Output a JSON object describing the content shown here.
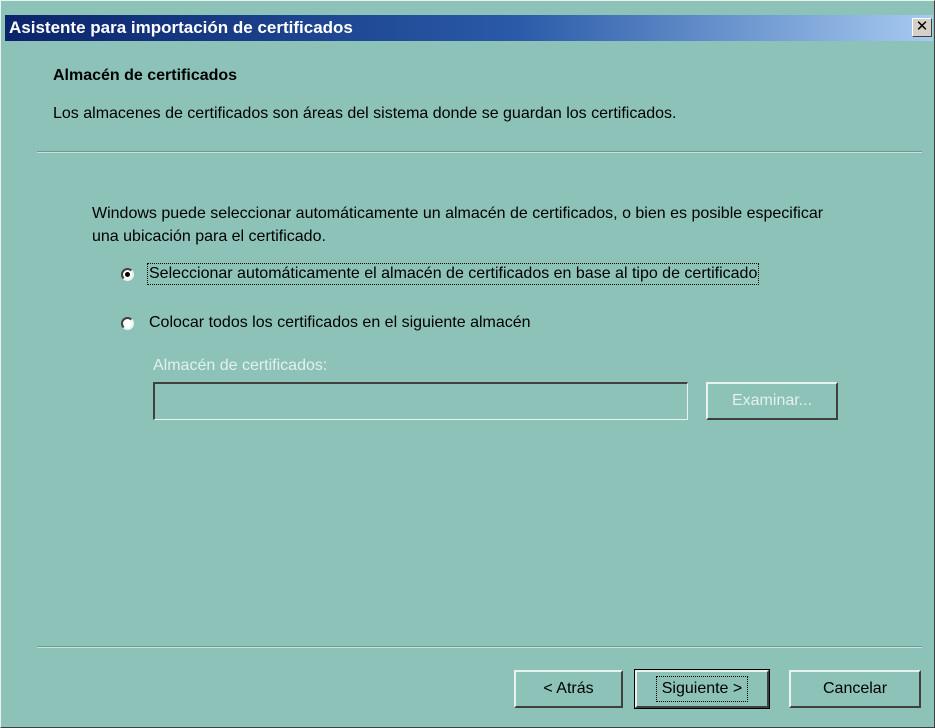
{
  "window": {
    "title": "Asistente para importación de certificados",
    "close_glyph": "✕"
  },
  "header": {
    "title": "Almacén de certificados",
    "description": "Los almacenes de certificados son áreas del sistema donde se guardan los certificados."
  },
  "body": {
    "intro": "Windows puede seleccionar automáticamente un almacén de certificados, o bien es posible especificar una ubicación para el certificado.",
    "options": [
      {
        "label": "Seleccionar automáticamente el almacén de certificados en base al tipo de certificado",
        "checked": true
      },
      {
        "label": "Colocar todos los certificados en el siguiente almacén",
        "checked": false
      }
    ],
    "store_field": {
      "label": "Almacén de certificados:",
      "value": "",
      "enabled": false
    },
    "browse_button": "Examinar..."
  },
  "footer": {
    "back_button": "< Atrás",
    "next_button": "Siguiente >",
    "cancel_button": "Cancelar"
  },
  "colors": {
    "dialog_bg": "#8cc2b8",
    "titlebar_start": "#0a246a",
    "titlebar_end": "#a6caf0"
  }
}
